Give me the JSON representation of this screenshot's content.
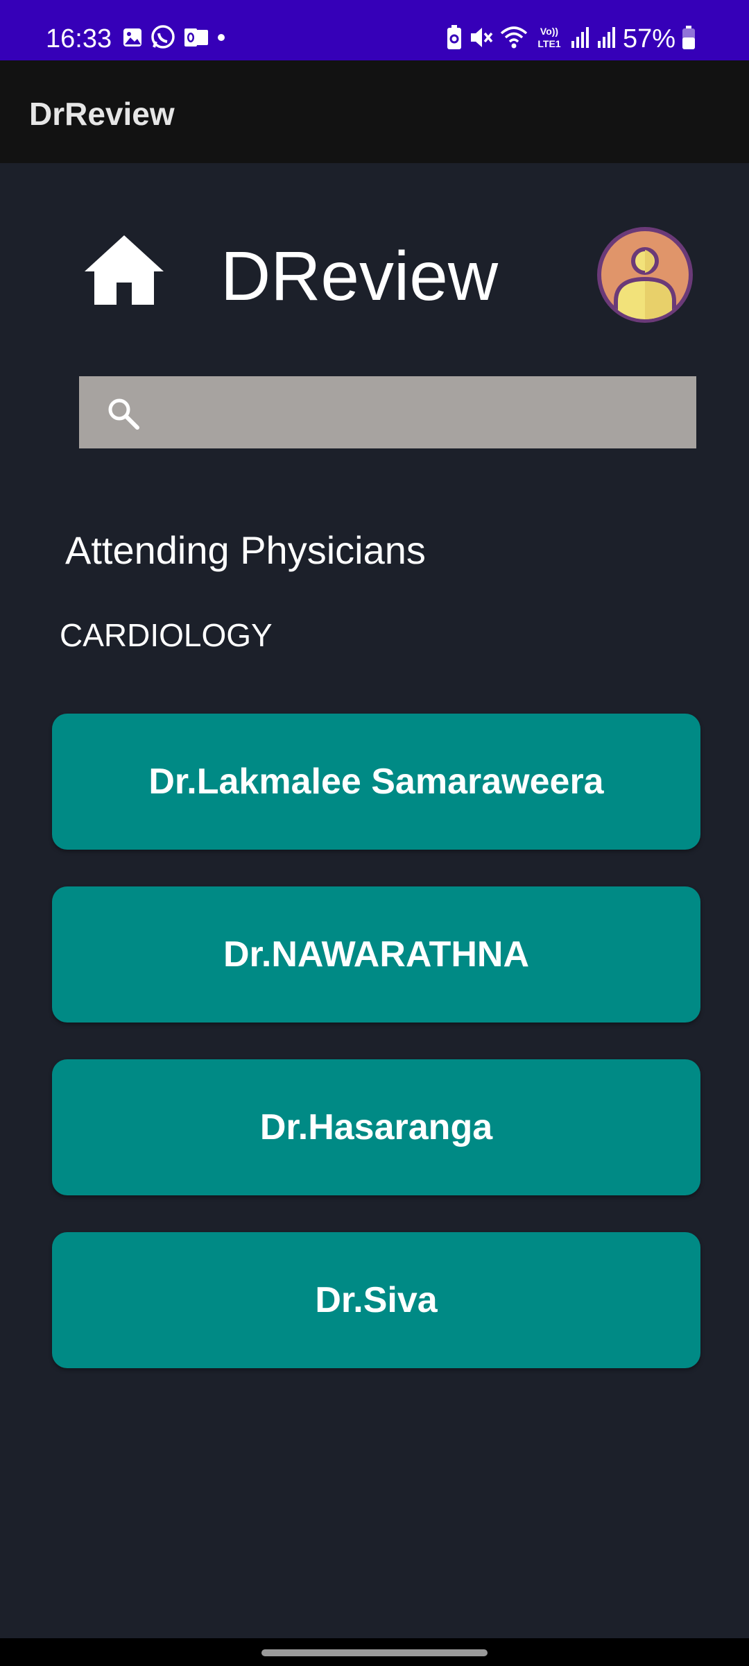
{
  "status_bar": {
    "time": "16:33",
    "battery_percent": "57%",
    "network_label": "Vo)) LTE1",
    "background_color": "#3600b8",
    "left_icons": [
      "gallery-icon",
      "whatsapp-icon",
      "outlook-icon",
      "notification-dot-icon"
    ],
    "right_icons": [
      "battery-saver-icon",
      "mute-icon",
      "wifi-icon",
      "volte-icon",
      "signal-icon",
      "signal-icon",
      "battery-icon"
    ]
  },
  "app_bar": {
    "title": "DrReview",
    "background_color": "#121212"
  },
  "header": {
    "brand": "DReview",
    "home_icon": "home-icon",
    "avatar_icon": "user-avatar-icon"
  },
  "search": {
    "placeholder": "",
    "value": "",
    "icon": "search-icon",
    "background_color": "#a7a3a0"
  },
  "section": {
    "title": "Attending Physicians",
    "department": "CARDIOLOGY"
  },
  "doctors": [
    {
      "name": "Dr.Lakmalee Samaraweera"
    },
    {
      "name": "Dr.NAWARATHNA"
    },
    {
      "name": "Dr.Hasaranga"
    },
    {
      "name": "Dr.Siva"
    }
  ],
  "colors": {
    "page_background": "#1c202a",
    "doctor_button": "#008a85",
    "avatar_ring": "#6b3a78",
    "avatar_fill": "#e0956a",
    "avatar_figure": "#f2e27a"
  }
}
